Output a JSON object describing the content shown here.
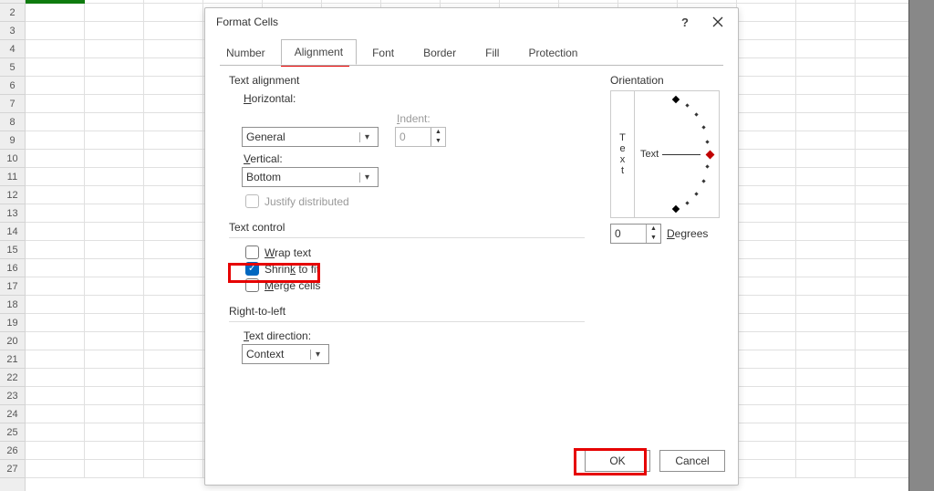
{
  "sheet": {
    "row_start": 2,
    "row_count": 26
  },
  "dialog": {
    "title": "Format Cells",
    "tabs": [
      "Number",
      "Alignment",
      "Font",
      "Border",
      "Fill",
      "Protection"
    ],
    "active_tab": 1,
    "text_alignment": {
      "group": "Text alignment",
      "horizontal_label": "Horizontal:",
      "horizontal_value": "General",
      "vertical_label": "Vertical:",
      "vertical_value": "Bottom",
      "indent_label": "Indent:",
      "indent_value": "0",
      "justify_label": "Justify distributed"
    },
    "text_control": {
      "group": "Text control",
      "wrap_label": "Wrap text",
      "wrap_checked": false,
      "shrink_label": "Shrink to fit",
      "shrink_checked": true,
      "merge_label": "Merge cells",
      "merge_checked": false
    },
    "rtl": {
      "group": "Right-to-left",
      "dir_label": "Text direction:",
      "dir_value": "Context"
    },
    "orientation": {
      "group": "Orientation",
      "vertical_text": "Text",
      "dial_text": "Text",
      "degrees_value": "0",
      "degrees_label": "Degrees"
    },
    "buttons": {
      "ok": "OK",
      "cancel": "Cancel"
    }
  }
}
